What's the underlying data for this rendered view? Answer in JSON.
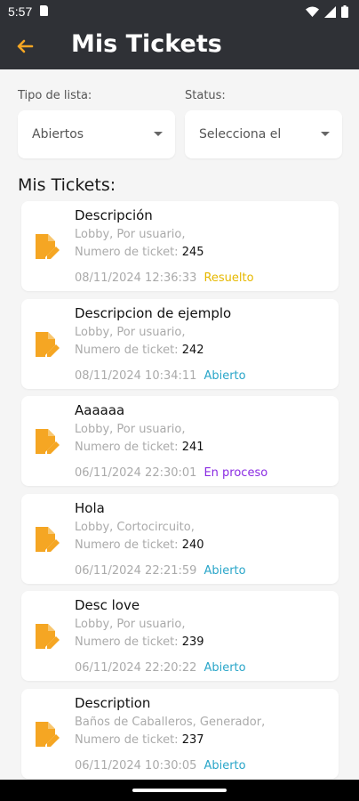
{
  "status_bar": {
    "time": "5:57"
  },
  "app_bar": {
    "title": "Mis Tickets"
  },
  "filters": {
    "list_type": {
      "label": "Tipo de lista:",
      "value": "Abiertos"
    },
    "status": {
      "label": "Status:",
      "value": "Selecciona el"
    }
  },
  "section_title": "Mis Tickets:",
  "colors": {
    "app_bar": "#2f3136",
    "accent": "#f5a623",
    "resuelto": "#e6b800",
    "abierto": "#2aa6c9",
    "en_proceso": "#8a2be2"
  },
  "tickets": [
    {
      "title": "Descripción",
      "location": "Lobby, Por usuario,",
      "number_label": "Numero de ticket:",
      "number": "245",
      "date": "08/11/2024 12:36:33",
      "status": "Resuelto",
      "status_color": "#e6b800"
    },
    {
      "title": "Descripcion de ejemplo",
      "location": "Lobby, Por usuario,",
      "number_label": "Numero de ticket:",
      "number": "242",
      "date": "08/11/2024 10:34:11",
      "status": "Abierto",
      "status_color": "#2aa6c9"
    },
    {
      "title": "Aaaaaa",
      "location": "Lobby, Por usuario,",
      "number_label": "Numero de ticket:",
      "number": "241",
      "date": "06/11/2024 22:30:01",
      "status": "En proceso",
      "status_color": "#8a2be2"
    },
    {
      "title": "Hola",
      "location": "Lobby, Cortocircuito,",
      "number_label": "Numero de ticket:",
      "number": "240",
      "date": "06/11/2024 22:21:59",
      "status": "Abierto",
      "status_color": "#2aa6c9"
    },
    {
      "title": "Desc love",
      "location": "Lobby, Por usuario,",
      "number_label": "Numero de ticket:",
      "number": "239",
      "date": "06/11/2024 22:20:22",
      "status": "Abierto",
      "status_color": "#2aa6c9"
    },
    {
      "title": "Description",
      "location": "Baños de Caballeros, Generador,",
      "number_label": "Numero de ticket:",
      "number": "237",
      "date": "06/11/2024 10:30:05",
      "status": "Abierto",
      "status_color": "#2aa6c9"
    }
  ]
}
